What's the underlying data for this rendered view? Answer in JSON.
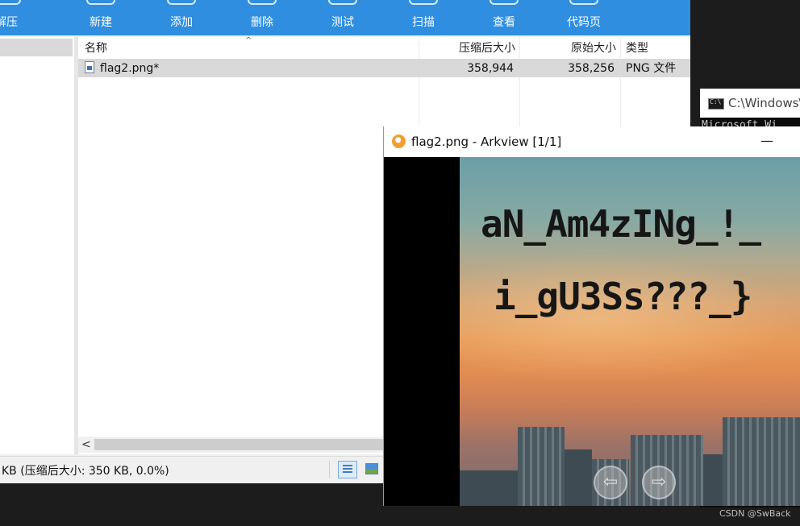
{
  "archive": {
    "toolbar": [
      {
        "label": "解压",
        "icon": "extract-icon"
      },
      {
        "label": "新建",
        "icon": "new-archive-icon"
      },
      {
        "label": "添加",
        "icon": "add-files-icon"
      },
      {
        "label": "删除",
        "icon": "delete-icon"
      },
      {
        "label": "测试",
        "icon": "test-icon"
      },
      {
        "label": "扫描",
        "icon": "scan-icon"
      },
      {
        "label": "查看",
        "icon": "view-icon"
      },
      {
        "label": "代码页",
        "icon": "codepage-icon"
      }
    ],
    "columns": {
      "name": "名称",
      "compressed": "压缩后大小",
      "original": "原始大小",
      "type": "类型"
    },
    "files": [
      {
        "name": "flag2.png*",
        "compressed": "358,944",
        "original": "358,256",
        "type": "PNG 文件"
      }
    ],
    "status": "KB (压缩后大小: 350 KB, 0.0%)",
    "scroll_left": "<",
    "sort_indicator": "^"
  },
  "console": {
    "title": "C:\\Windows\\",
    "line": "Microsoft Wi"
  },
  "viewer": {
    "title": "flag2.png - Arkview [1/1]",
    "minimize": "—",
    "image_text": [
      "aN_Am4zINg_!_",
      "i_gU3Ss???_}"
    ],
    "nav_prev": "⇦",
    "nav_next": "⇨"
  },
  "watermark": "CSDN @SwBack",
  "colors": {
    "toolbar": "#2f8ee0",
    "selected_row": "#d9d9d9",
    "console_bg": "#0c0c0c"
  }
}
